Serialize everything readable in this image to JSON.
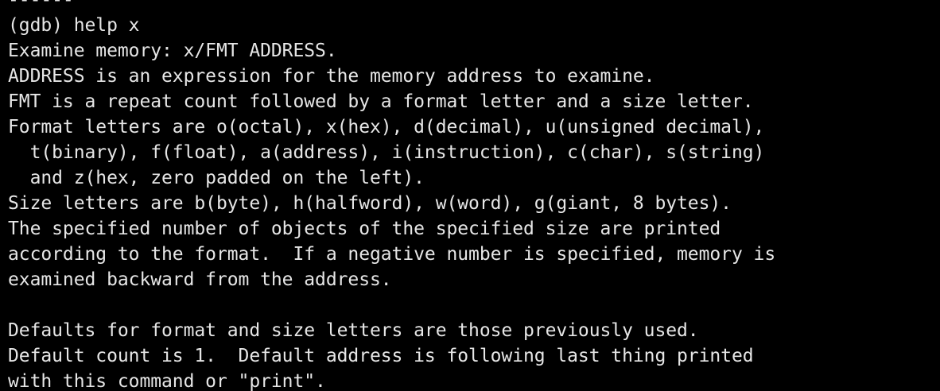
{
  "terminal": {
    "lines": [
      "------",
      "(gdb) help x",
      "Examine memory: x/FMT ADDRESS.",
      "ADDRESS is an expression for the memory address to examine.",
      "FMT is a repeat count followed by a format letter and a size letter.",
      "Format letters are o(octal), x(hex), d(decimal), u(unsigned decimal),",
      "  t(binary), f(float), a(address), i(instruction), c(char), s(string)",
      "  and z(hex, zero padded on the left).",
      "Size letters are b(byte), h(halfword), w(word), g(giant, 8 bytes).",
      "The specified number of objects of the specified size are printed",
      "according to the format.  If a negative number is specified, memory is",
      "examined backward from the address.",
      "",
      "Defaults for format and size letters are those previously used.",
      "Default count is 1.  Default address is following last thing printed",
      "with this command or \"print\"."
    ]
  }
}
